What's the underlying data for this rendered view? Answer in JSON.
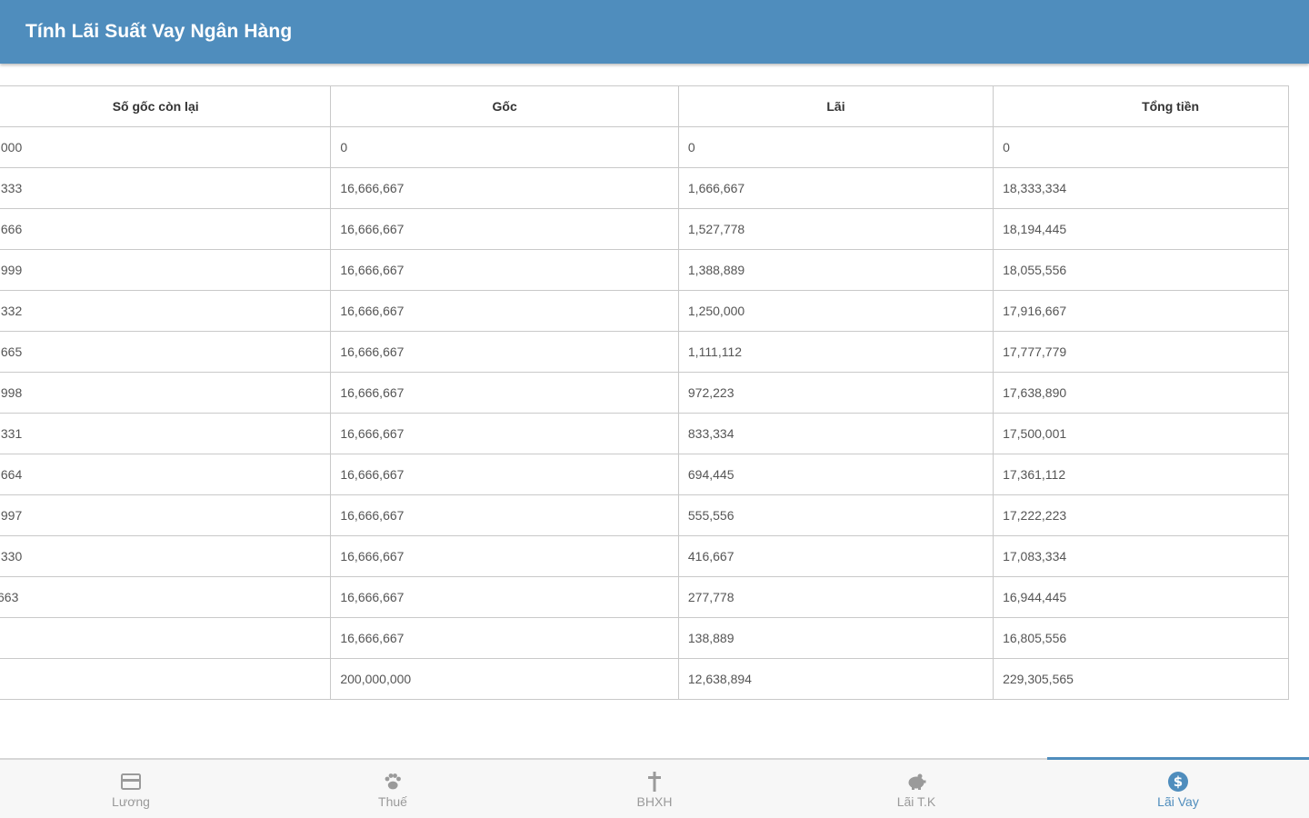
{
  "header": {
    "title": "Tính Lãi Suất Vay Ngân Hàng"
  },
  "table": {
    "columns": [
      "Số gốc còn lại",
      "Gốc",
      "Lãi",
      "Tổng tiền"
    ],
    "rows": [
      [
        ",000",
        "0",
        "0",
        "0"
      ],
      [
        ",333",
        "16,666,667",
        "1,666,667",
        "18,333,334"
      ],
      [
        ",666",
        "16,666,667",
        "1,527,778",
        "18,194,445"
      ],
      [
        ",999",
        "16,666,667",
        "1,388,889",
        "18,055,556"
      ],
      [
        ",332",
        "16,666,667",
        "1,250,000",
        "17,916,667"
      ],
      [
        ",665",
        "16,666,667",
        "1,111,112",
        "17,777,779"
      ],
      [
        ",998",
        "16,666,667",
        "972,223",
        "17,638,890"
      ],
      [
        ",331",
        "16,666,667",
        "833,334",
        "17,500,001"
      ],
      [
        ",664",
        "16,666,667",
        "694,445",
        "17,361,112"
      ],
      [
        ",997",
        "16,666,667",
        "555,556",
        "17,222,223"
      ],
      [
        ",330",
        "16,666,667",
        "416,667",
        "17,083,334"
      ],
      [
        "663",
        "16,666,667",
        "277,778",
        "16,944,445"
      ],
      [
        "",
        "16,666,667",
        "138,889",
        "16,805,556"
      ],
      [
        "",
        "200,000,000",
        "12,638,894",
        "229,305,565"
      ]
    ]
  },
  "tabs": [
    {
      "label": "Lương",
      "icon": "card-icon",
      "active": false
    },
    {
      "label": "Thuế",
      "icon": "paw-icon",
      "active": false
    },
    {
      "label": "BHXH",
      "icon": "cross-icon",
      "active": false
    },
    {
      "label": "Lãi T.K",
      "icon": "piggy-bank-icon",
      "active": false
    },
    {
      "label": "Lãi Vay",
      "icon": "dollar-icon",
      "active": true
    }
  ],
  "colors": {
    "header_bg": "#4f8dbd",
    "active_tab": "#4f8dbd",
    "inactive_tab": "#9a9a9a"
  }
}
